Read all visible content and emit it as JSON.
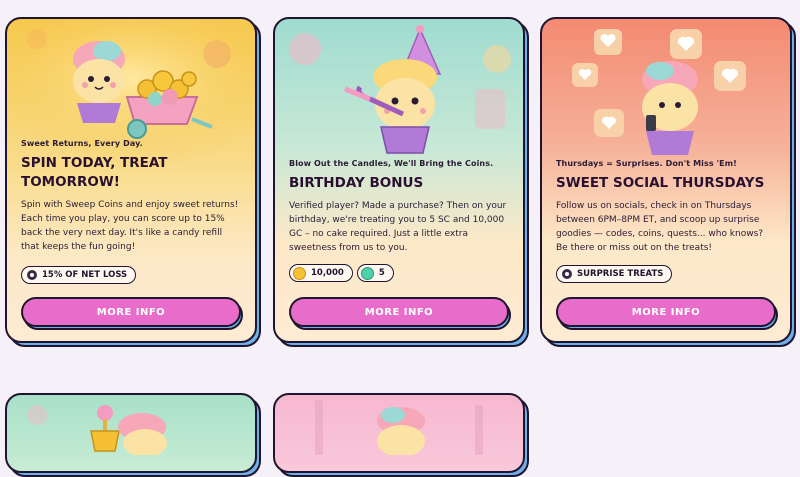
{
  "promos": [
    {
      "kicker": "Sweet Returns, Every Day.",
      "title_line1": "SPIN TODAY, TREAT",
      "title_line2": "TOMORROW!",
      "description": "Spin with Sweep Coins and enjoy sweet returns! Each time you play, you can score up to 15% back the very next day. It's like a candy refill that keeps the fun going!",
      "chip_label": "15% OF NET LOSS",
      "button_label": "MORE INFO",
      "bg_top": "#f6cf52",
      "bg_bottom": "#fde9c8"
    },
    {
      "kicker": "Blow Out the Candles, We'll Bring the Coins.",
      "title": "BIRTHDAY BONUS",
      "description": "Verified player? Made a purchase? Then on your birthday, we're treating you to 5 SC and 10,000 GC – no cake required. Just a little extra sweetness from us to you.",
      "gold_amount": "10,000",
      "sweep_amount": "5",
      "button_label": "MORE INFO",
      "bg_top": "#9fdcd0",
      "bg_bottom": "#fde9c8"
    },
    {
      "kicker": "Thursdays = Surprises. Don't Miss 'Em!",
      "title": "SWEET SOCIAL THURSDAYS",
      "description": "Follow us on socials, check in on Thursdays between 6PM–8PM ET, and scoop up surprise goodies — codes, coins, quests... who knows? Be there or miss out on the treats!",
      "chip_label": "SURPRISE TREATS",
      "button_label": "MORE INFO",
      "bg_top": "#f4927a",
      "bg_bottom": "#fde9c8"
    }
  ],
  "colors": {
    "button": "#e86cc9",
    "shadow": "#6fb0e8",
    "outline": "#1f1530"
  }
}
